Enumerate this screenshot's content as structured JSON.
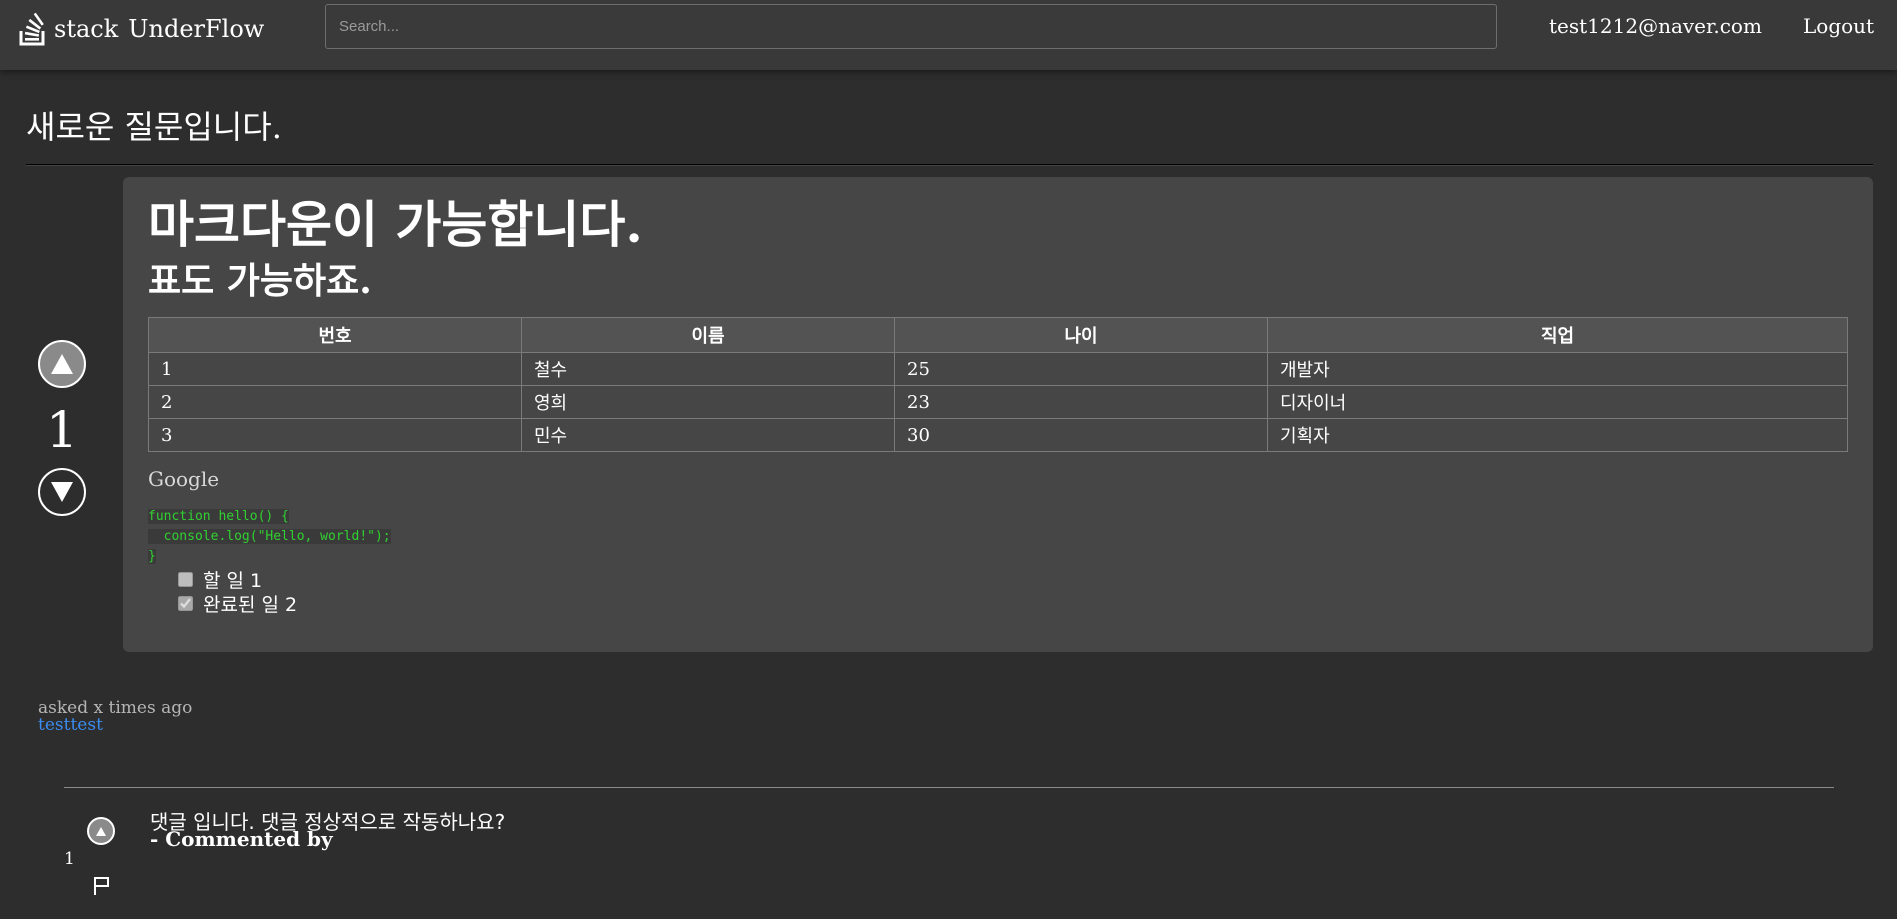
{
  "header": {
    "brand_part1": "stack",
    "brand_part2": "UnderFlow",
    "search_placeholder": "Search...",
    "user_email": "test1212@naver.com",
    "logout_label": "Logout"
  },
  "question": {
    "title": "새로운 질문입니다.",
    "votes": "1",
    "body": {
      "heading1": "마크다운이 가능합니다.",
      "heading2": "표도 가능하죠.",
      "table": {
        "headers": [
          "번호",
          "이름",
          "나이",
          "직업"
        ],
        "rows": [
          [
            "1",
            "철수",
            "25",
            "개발자"
          ],
          [
            "2",
            "영희",
            "23",
            "디자이너"
          ],
          [
            "3",
            "민수",
            "30",
            "기획자"
          ]
        ]
      },
      "link_text": "Google",
      "code_lines": [
        "function hello() {",
        "  console.log(\"Hello, world!\");",
        "}"
      ],
      "tasks": [
        {
          "label": "할 일 1",
          "checked": false
        },
        {
          "label": "완료된 일 2",
          "checked": true
        }
      ]
    },
    "asked_text": "asked x times ago",
    "author": "testtest"
  },
  "comments": [
    {
      "votes": "1",
      "text": "댓글 입니다. 댓글 정상적으로 작동하나요?",
      "by": "- Commented by"
    }
  ],
  "colors": {
    "background": "#2d2d2d",
    "header": "#393939",
    "card": "#464646",
    "code": "#31d131",
    "link": "#3b8cf0"
  }
}
